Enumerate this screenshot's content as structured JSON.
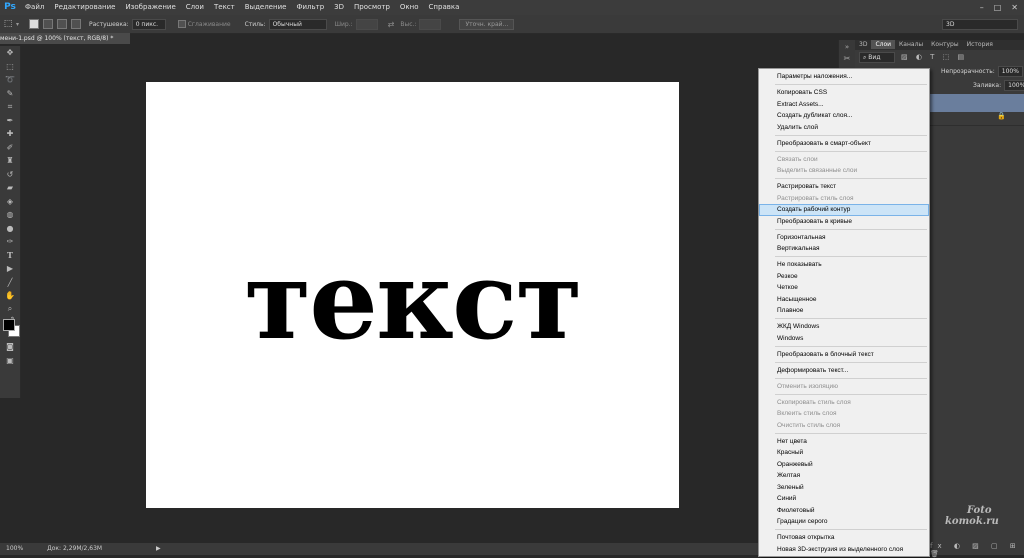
{
  "app": {
    "logo": "Ps"
  },
  "menubar": {
    "items": [
      "Файл",
      "Редактирование",
      "Изображение",
      "Слои",
      "Текст",
      "Выделение",
      "Фильтр",
      "3D",
      "Просмотр",
      "Окно",
      "Справка"
    ],
    "window_buttons": [
      "–",
      "□",
      "✕"
    ]
  },
  "options_bar": {
    "feather_label": "Растушевка:",
    "feather_value": "0 пикс.",
    "antialias_label": "Сглаживание",
    "style_label": "Стиль:",
    "style_value": "Обычный",
    "width_label": "Шир.:",
    "height_label": "Выс.:",
    "refine_button": "Уточн. край...",
    "workspace_value": "3D"
  },
  "document": {
    "tab_title": "мени-1.psd @ 100% (текст, RGB/8) *"
  },
  "canvas": {
    "text": "текст"
  },
  "status": {
    "zoom": "100%",
    "doc_info": "Док: 2,29M/2,63M"
  },
  "panels": {
    "tabs": [
      "3D",
      "Слои",
      "Каналы",
      "Контуры",
      "История"
    ],
    "active_tab": "Слои",
    "kind_label": "Вид",
    "opacity_label": "Непрозрачность:",
    "opacity_value": "100%",
    "fill_label": "Заливка:",
    "fill_value": "100%"
  },
  "context_menu": {
    "groups": [
      [
        {
          "label": "Параметры наложения...",
          "enabled": true
        }
      ],
      [
        {
          "label": "Копировать CSS",
          "enabled": true
        },
        {
          "label": "Extract Assets...",
          "enabled": true
        },
        {
          "label": "Создать дубликат слоя...",
          "enabled": true
        },
        {
          "label": "Удалить слой",
          "enabled": true
        }
      ],
      [
        {
          "label": "Преобразовать в смарт-объект",
          "enabled": true
        }
      ],
      [
        {
          "label": "Связать слои",
          "enabled": false
        },
        {
          "label": "Выделить связанные слои",
          "enabled": false
        }
      ],
      [
        {
          "label": "Растрировать текст",
          "enabled": true
        },
        {
          "label": "Растрировать стиль слоя",
          "enabled": false
        },
        {
          "label": "Создать рабочий контур",
          "enabled": true,
          "highlighted": true
        },
        {
          "label": "Преобразовать в кривые",
          "enabled": true
        }
      ],
      [
        {
          "label": "Горизонтальная",
          "enabled": true
        },
        {
          "label": "Вертикальная",
          "enabled": true
        }
      ],
      [
        {
          "label": "Не показывать",
          "enabled": true
        },
        {
          "label": "Резкое",
          "enabled": true
        },
        {
          "label": "Четкое",
          "enabled": true
        },
        {
          "label": "Насыщенное",
          "enabled": true
        },
        {
          "label": "Плавное",
          "enabled": true
        }
      ],
      [
        {
          "label": "ЖКД Windows",
          "enabled": true
        },
        {
          "label": "Windows",
          "enabled": true
        }
      ],
      [
        {
          "label": "Преобразовать в блочный текст",
          "enabled": true
        }
      ],
      [
        {
          "label": "Деформировать текст...",
          "enabled": true
        }
      ],
      [
        {
          "label": "Отменить изоляцию",
          "enabled": false
        }
      ],
      [
        {
          "label": "Скопировать стиль слоя",
          "enabled": false
        },
        {
          "label": "Вклеить стиль слоя",
          "enabled": false
        },
        {
          "label": "Очистить стиль слоя",
          "enabled": false
        }
      ],
      [
        {
          "label": "Нет цвета",
          "enabled": true
        },
        {
          "label": "Красный",
          "enabled": true
        },
        {
          "label": "Оранжевый",
          "enabled": true
        },
        {
          "label": "Желтая",
          "enabled": true
        },
        {
          "label": "Зеленый",
          "enabled": true
        },
        {
          "label": "Синий",
          "enabled": true
        },
        {
          "label": "Фиолетовый",
          "enabled": true
        },
        {
          "label": "Градации серого",
          "enabled": true
        }
      ],
      [
        {
          "label": "Почтовая открытка",
          "enabled": true
        },
        {
          "label": "Новая 3D-экструзия из выделенного слоя",
          "enabled": true
        }
      ]
    ]
  },
  "watermark": {
    "line1": "Foto",
    "line2": "komok.ru"
  },
  "colors": {
    "accent": "#31a8ff",
    "highlight": "#cce4f7",
    "selected_layer": "#6a7e9d"
  }
}
